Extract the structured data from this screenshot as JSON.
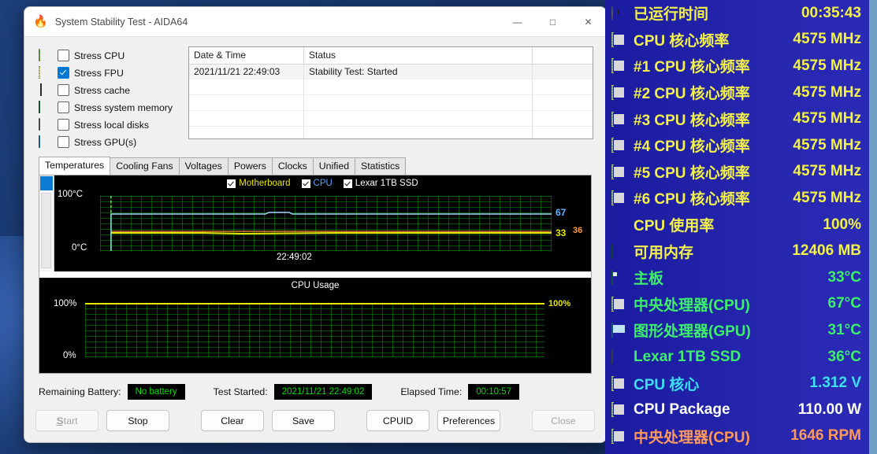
{
  "window": {
    "title": "System Stability Test - AIDA64",
    "app_icon": "flame-icon",
    "minimize_label": "—",
    "maximize_label": "□",
    "close_label": "✕"
  },
  "stress_options": [
    {
      "label": "Stress CPU",
      "checked": false,
      "icon": "cpu-icon"
    },
    {
      "label": "Stress FPU",
      "checked": true,
      "icon": "fpu-icon"
    },
    {
      "label": "Stress cache",
      "checked": false,
      "icon": "cache-icon"
    },
    {
      "label": "Stress system memory",
      "checked": false,
      "icon": "memory-icon"
    },
    {
      "label": "Stress local disks",
      "checked": false,
      "icon": "disk-icon"
    },
    {
      "label": "Stress GPU(s)",
      "checked": false,
      "icon": "gpu-icon"
    }
  ],
  "log": {
    "columns": [
      "Date & Time",
      "Status",
      ""
    ],
    "rows": [
      {
        "datetime": "2021/11/21 22:49:03",
        "status": "Stability Test: Started"
      }
    ]
  },
  "tabs": [
    {
      "label": "Temperatures",
      "active": true
    },
    {
      "label": "Cooling Fans",
      "active": false
    },
    {
      "label": "Voltages",
      "active": false
    },
    {
      "label": "Powers",
      "active": false
    },
    {
      "label": "Clocks",
      "active": false
    },
    {
      "label": "Unified",
      "active": false
    },
    {
      "label": "Statistics",
      "active": false
    }
  ],
  "chart_data": [
    {
      "type": "line",
      "name": "temperatures-chart",
      "title": "",
      "xlabel": "",
      "ylabel": "",
      "ylim": [
        0,
        100
      ],
      "y_top_label": "100°C",
      "y_bottom_label": "0°C",
      "x_tick_labels": [
        "22:49:02"
      ],
      "grid": true,
      "legend_position": "top-center",
      "series": [
        {
          "name": "Motherboard",
          "color": "#e8e800",
          "current": 33,
          "value_label": "33",
          "checked": true,
          "values": [
            33,
            33,
            33,
            33,
            33,
            33,
            33,
            33,
            33,
            33,
            33,
            33,
            33,
            33,
            33,
            33,
            33,
            33,
            33,
            33
          ]
        },
        {
          "name": "CPU",
          "color": "#9fd8ff",
          "current": 67,
          "value_label": "67",
          "checked": true,
          "values": [
            30,
            67,
            67,
            67,
            67,
            67,
            67,
            67,
            67,
            67,
            67,
            67,
            67,
            67,
            67,
            67,
            67,
            67,
            67,
            67
          ]
        },
        {
          "name": "Lexar 1TB SSD",
          "color": "#ff9a3c",
          "current": 36,
          "value_label": "36",
          "checked": true,
          "values": [
            36,
            36,
            36,
            36,
            36,
            36,
            36,
            36,
            36,
            36,
            36,
            36,
            36,
            36,
            36,
            36,
            36,
            36,
            36,
            36
          ]
        }
      ]
    },
    {
      "type": "line",
      "name": "cpu-usage-chart",
      "title": "CPU Usage",
      "xlabel": "",
      "ylabel": "",
      "ylim": [
        0,
        100
      ],
      "y_top_label": "100%",
      "y_bottom_label": "0%",
      "y_right_label": "100%",
      "grid": true,
      "series": [
        {
          "name": "CPU Usage",
          "color": "#e8e800",
          "current": 100,
          "values": [
            100,
            100,
            100,
            100,
            100,
            100,
            100,
            100,
            100,
            100,
            100,
            100,
            100,
            100,
            100,
            100,
            100,
            100,
            100,
            100
          ]
        }
      ]
    }
  ],
  "status": {
    "battery_label": "Remaining Battery:",
    "battery_value": "No battery",
    "started_label": "Test Started:",
    "started_value": "2021/11/21 22:49:02",
    "elapsed_label": "Elapsed Time:",
    "elapsed_value": "00:10:57"
  },
  "buttons": [
    {
      "label": "Start",
      "accel": "S",
      "disabled": true
    },
    {
      "label": "Stop",
      "accel": "t",
      "disabled": false
    },
    {
      "label": "Clear",
      "accel": "e",
      "disabled": false
    },
    {
      "label": "Save",
      "accel": "a",
      "disabled": false
    },
    {
      "label": "CPUID",
      "accel": "U",
      "disabled": false
    },
    {
      "label": "Preferences",
      "accel": "P",
      "disabled": false
    },
    {
      "label": "Close",
      "accel": "C",
      "disabled": true
    }
  ],
  "osd": {
    "background_color": "#2222a8",
    "rows": [
      {
        "icon": "clock-icon",
        "label": "已运行时间",
        "value": "00:35:43",
        "color": "#f2f24a"
      },
      {
        "icon": "chip-icon",
        "label": "CPU 核心频率",
        "value": "4575 MHz",
        "color": "#f2f24a"
      },
      {
        "icon": "chip-icon",
        "label": "#1 CPU 核心频率",
        "value": "4575 MHz",
        "color": "#f2f24a"
      },
      {
        "icon": "chip-icon",
        "label": "#2 CPU 核心频率",
        "value": "4575 MHz",
        "color": "#f2f24a"
      },
      {
        "icon": "chip-icon",
        "label": "#3 CPU 核心频率",
        "value": "4575 MHz",
        "color": "#f2f24a"
      },
      {
        "icon": "chip-icon",
        "label": "#4 CPU 核心频率",
        "value": "4575 MHz",
        "color": "#f2f24a"
      },
      {
        "icon": "chip-icon",
        "label": "#5 CPU 核心频率",
        "value": "4575 MHz",
        "color": "#f2f24a"
      },
      {
        "icon": "chip-icon",
        "label": "#6 CPU 核心频率",
        "value": "4575 MHz",
        "color": "#f2f24a"
      },
      {
        "icon": "hourglass-icon",
        "label": "CPU 使用率",
        "value": "100%",
        "color": "#f2f24a"
      },
      {
        "icon": "memory-icon",
        "label": "可用内存",
        "value": "12406 MB",
        "color": "#f2f24a"
      },
      {
        "icon": "mobo-icon",
        "label": "主板",
        "value": "33°C",
        "color": "#3cf06a"
      },
      {
        "icon": "chip-icon",
        "label": "中央处理器(CPU)",
        "value": "67°C",
        "color": "#3cf06a"
      },
      {
        "icon": "gpu-icon",
        "label": "图形处理器(GPU)",
        "value": "31°C",
        "color": "#3cf06a"
      },
      {
        "icon": "disk-icon",
        "label": "Lexar 1TB SSD",
        "value": "36°C",
        "color": "#3cf06a"
      },
      {
        "icon": "chip-icon",
        "label": "CPU 核心",
        "value": "1.312 V",
        "color": "#3ce0f0"
      },
      {
        "icon": "chip-icon",
        "label": "CPU Package",
        "value": "110.00 W",
        "color": "#ffffff"
      },
      {
        "icon": "chip-icon",
        "label": "中央处理器(CPU)",
        "value": "1646 RPM",
        "color": "#ff9a5c"
      }
    ]
  }
}
